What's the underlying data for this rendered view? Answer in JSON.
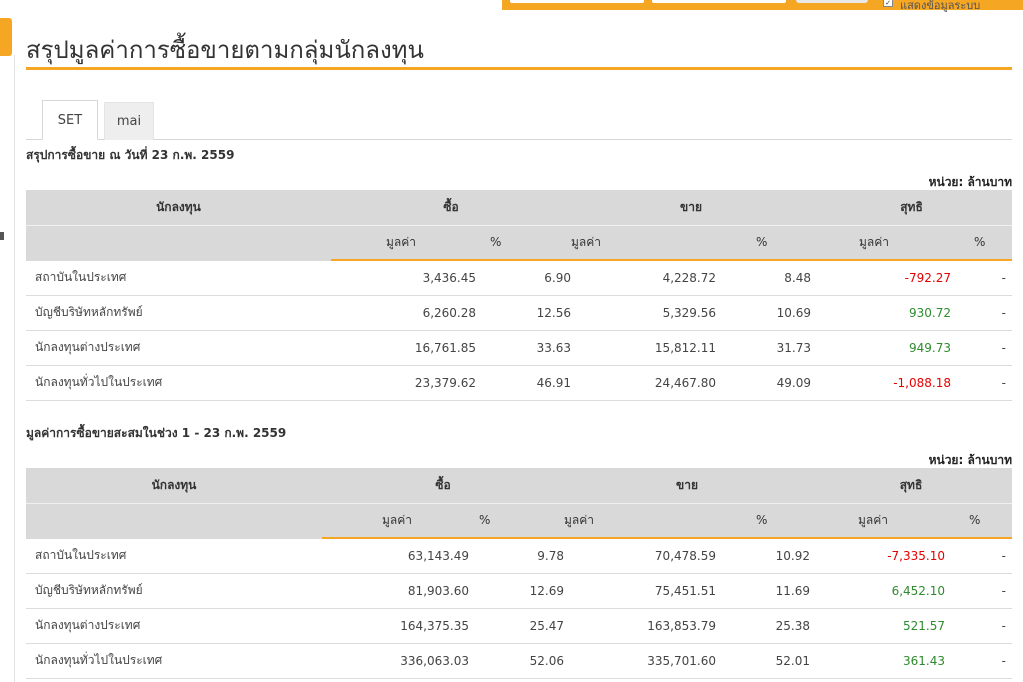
{
  "header": {
    "top_checkbox_mark": "✓",
    "top_checkbox_label": "แสดงข้อมูลระบบ"
  },
  "page": {
    "title": "สรุปมูลค่าการซื้อขายตามกลุ่มนักลงทุน"
  },
  "tabs": [
    {
      "label": "SET",
      "active": true
    },
    {
      "label": "mai",
      "active": false
    }
  ],
  "columns": {
    "investor": "นักลงทุน",
    "buy": "ซื้อ",
    "sell": "ขาย",
    "net": "สุทธิ",
    "value": "มูลค่า",
    "percent": "%"
  },
  "colors": {
    "accent": "#f5a623",
    "negative": "#e60000",
    "positive": "#2e8b2e"
  },
  "daily": {
    "title": "สรุปการซื้อขาย ณ วันที่ 23 ก.พ. 2559",
    "unit": "หน่วย: ล้านบาท",
    "rows": [
      {
        "name": "สถาบันในประเทศ",
        "buy_value": "3,436.45",
        "buy_pct": "6.90",
        "sell_value": "4,228.72",
        "sell_pct": "8.48",
        "net_value": "-792.27",
        "net_pct": "-"
      },
      {
        "name": "บัญชีบริษัทหลักทรัพย์",
        "buy_value": "6,260.28",
        "buy_pct": "12.56",
        "sell_value": "5,329.56",
        "sell_pct": "10.69",
        "net_value": "930.72",
        "net_pct": "-"
      },
      {
        "name": "นักลงทุนต่างประเทศ",
        "buy_value": "16,761.85",
        "buy_pct": "33.63",
        "sell_value": "15,812.11",
        "sell_pct": "31.73",
        "net_value": "949.73",
        "net_pct": "-"
      },
      {
        "name": "นักลงทุนทั่วไปในประเทศ",
        "buy_value": "23,379.62",
        "buy_pct": "46.91",
        "sell_value": "24,467.80",
        "sell_pct": "49.09",
        "net_value": "-1,088.18",
        "net_pct": "-"
      }
    ]
  },
  "cumulative": {
    "title": "มูลค่าการซื้อขายสะสมในช่วง 1 - 23 ก.พ. 2559",
    "unit": "หน่วย: ล้านบาท",
    "rows": [
      {
        "name": "สถาบันในประเทศ",
        "buy_value": "63,143.49",
        "buy_pct": "9.78",
        "sell_value": "70,478.59",
        "sell_pct": "10.92",
        "net_value": "-7,335.10",
        "net_pct": "-"
      },
      {
        "name": "บัญชีบริษัทหลักทรัพย์",
        "buy_value": "81,903.60",
        "buy_pct": "12.69",
        "sell_value": "75,451.51",
        "sell_pct": "11.69",
        "net_value": "6,452.10",
        "net_pct": "-"
      },
      {
        "name": "นักลงทุนต่างประเทศ",
        "buy_value": "164,375.35",
        "buy_pct": "25.47",
        "sell_value": "163,853.79",
        "sell_pct": "25.38",
        "net_value": "521.57",
        "net_pct": "-"
      },
      {
        "name": "นักลงทุนทั่วไปในประเทศ",
        "buy_value": "336,063.03",
        "buy_pct": "52.06",
        "sell_value": "335,701.60",
        "sell_pct": "52.01",
        "net_value": "361.43",
        "net_pct": "-"
      }
    ]
  }
}
